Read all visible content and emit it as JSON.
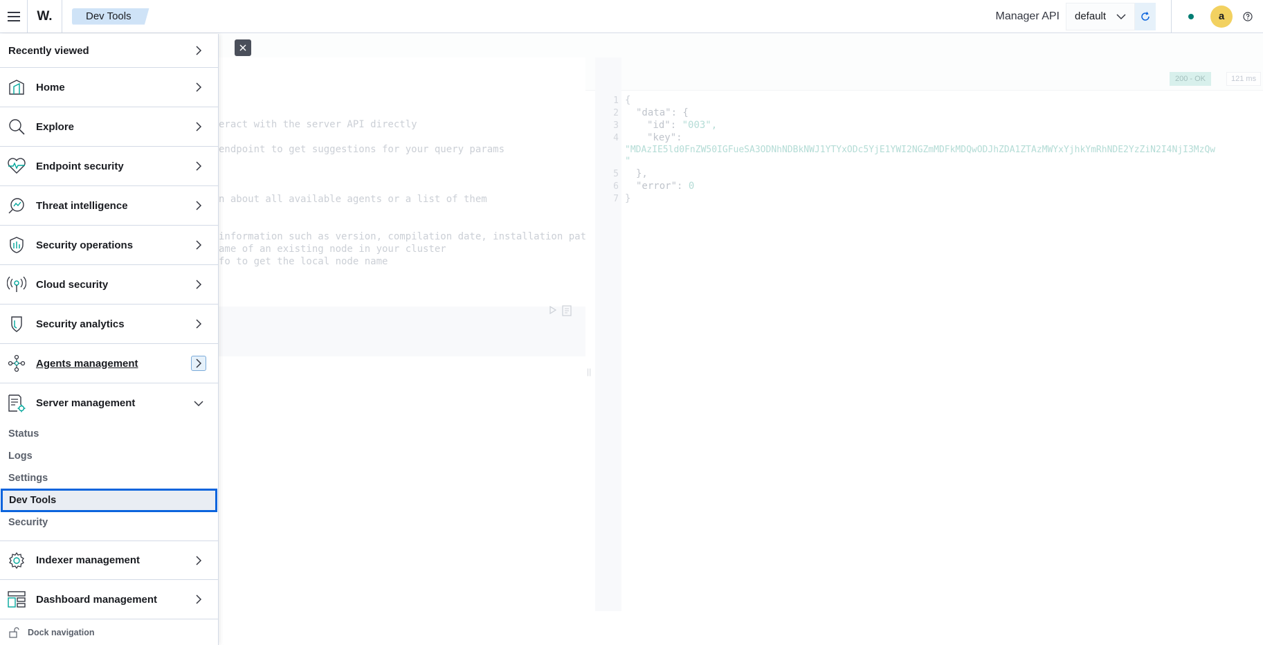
{
  "header": {
    "logo": "W.",
    "breadcrumb": "Dev Tools",
    "manager_label": "Manager API",
    "env_select": "default",
    "avatar_initial": "a",
    "status_color": "#017d73"
  },
  "sidenav": {
    "recently_viewed": "Recently viewed",
    "sections": [
      {
        "label": "Home",
        "icon": "home-icon"
      },
      {
        "label": "Explore",
        "icon": "search-icon"
      },
      {
        "label": "Endpoint security",
        "icon": "heart-pulse-icon"
      },
      {
        "label": "Threat intelligence",
        "icon": "threat-icon"
      },
      {
        "label": "Security operations",
        "icon": "shield-icon"
      },
      {
        "label": "Cloud security",
        "icon": "antenna-icon"
      },
      {
        "label": "Security analytics",
        "icon": "shield-analytics-icon"
      },
      {
        "label": "Agents management",
        "icon": "nodes-icon"
      },
      {
        "label": "Server management",
        "icon": "server-doc-icon"
      },
      {
        "label": "Indexer management",
        "icon": "gear-icon"
      },
      {
        "label": "Dashboard management",
        "icon": "dashboard-icon"
      }
    ],
    "server_sub_items": [
      "Status",
      "Logs",
      "Settings",
      "Dev Tools",
      "Security"
    ],
    "active_sub_item": "Dev Tools",
    "dock": "Dock navigation"
  },
  "console": {
    "request_lines": [
      "eract with the server API directly",
      " endpoint to get suggestions for your query params",
      "n about all available agents or a list of them",
      "information such as version, compilation date, installation pat",
      "ame of an existing node in your cluster",
      "fo to get the local node name"
    ],
    "status_badge": "200 - OK",
    "duration": "121 ms",
    "line_numbers": [
      "1",
      "2",
      "3",
      "4",
      "5",
      "6",
      "7"
    ],
    "response": {
      "open_brace": "{",
      "data_key": "\"data\": {",
      "id_key": "\"id\":",
      "id_value": "\"003\",",
      "key_key": "\"key\":",
      "key_value": "\"MDAzIE5ld0FnZW50IGFueSA3ODNhNDBkNWJ1YTYxODc5YjE1YWI2NGZmMDFkMDQwODJhZDA1ZTAzMWYxYjhkYmRhNDE2YzZiN2I4NjI3MzQw",
      "key_tail": "\"",
      "close_data": "},",
      "error_key": "\"error\":",
      "error_value": "0",
      "close_brace": "}"
    }
  }
}
